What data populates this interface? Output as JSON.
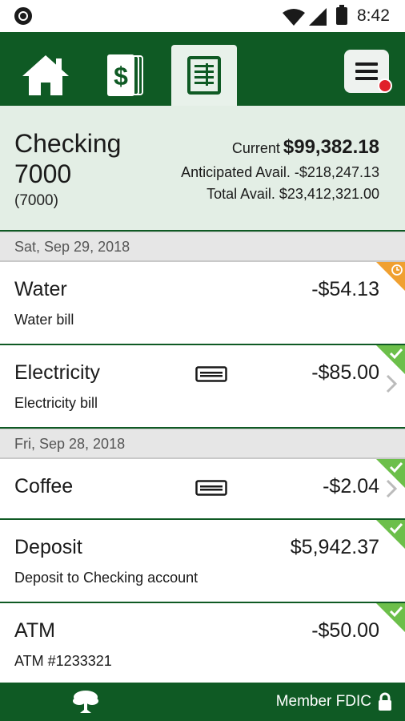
{
  "status_bar": {
    "time": "8:42"
  },
  "nav": {
    "tabs": [
      {
        "icon": "home-icon"
      },
      {
        "icon": "dollar-icon"
      },
      {
        "icon": "register-icon",
        "active": true
      }
    ],
    "menu_icon": "hamburger-menu-icon",
    "accent": "#0f5a24",
    "badge_color": "#e0202a"
  },
  "account": {
    "name": "Checking 7000",
    "number": "(7000)",
    "current_label": "Current",
    "current_value": "$99,382.18",
    "anticipated": "Anticipated Avail. -$218,247.13",
    "total": "Total Avail. $23,412,321.00"
  },
  "dates": [
    "Sat, Sep 29, 2018",
    "Fri, Sep 28, 2018"
  ],
  "transactions": [
    {
      "name": "Water",
      "desc": "Water bill",
      "amount": "-$54.13",
      "status": "pending"
    },
    {
      "name": "Electricity",
      "desc": "Electricity bill",
      "amount": "-$85.00",
      "status": "cleared",
      "card": true,
      "chevron": true
    },
    {
      "name": "Coffee",
      "desc": "",
      "amount": "-$2.04",
      "status": "cleared",
      "card": true,
      "chevron": true
    },
    {
      "name": "Deposit",
      "desc": "Deposit to Checking account",
      "amount": "$5,942.37",
      "status": "cleared"
    },
    {
      "name": "ATM",
      "desc": "ATM #1233321",
      "amount": "-$50.00",
      "status": "cleared"
    }
  ],
  "footer": {
    "fdic": "Member FDIC"
  }
}
